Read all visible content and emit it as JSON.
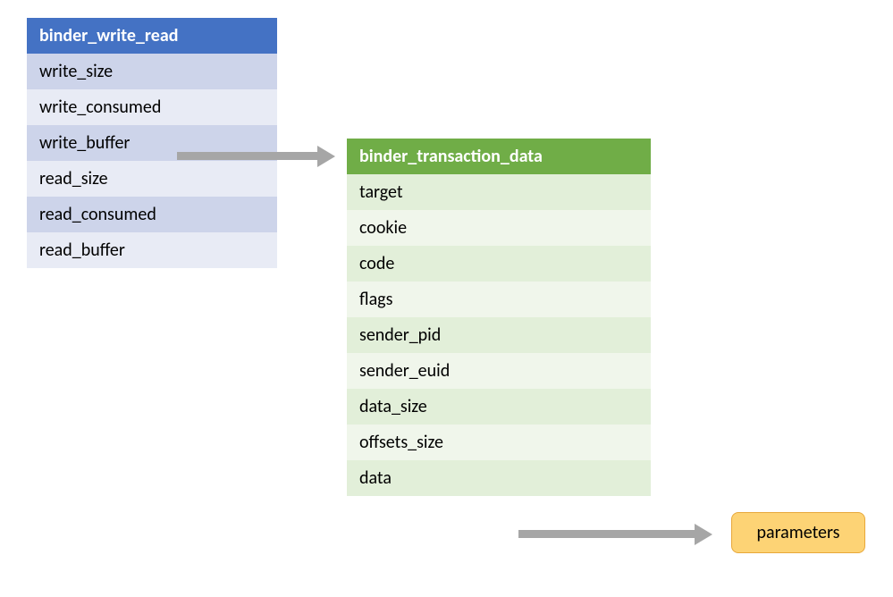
{
  "blue_table": {
    "header": "binder_write_read",
    "rows": [
      "write_size",
      "write_consumed",
      "write_buffer",
      "read_size",
      "read_consumed",
      "read_buffer"
    ]
  },
  "green_table": {
    "header": "binder_transaction_data",
    "rows": [
      "target",
      "cookie",
      "code",
      "flags",
      "sender_pid",
      "sender_euid",
      "data_size",
      "offsets_size",
      "data"
    ]
  },
  "parameters_label": "parameters"
}
